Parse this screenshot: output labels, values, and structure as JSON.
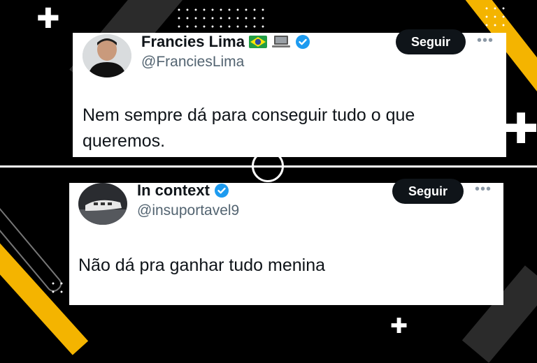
{
  "tweets": [
    {
      "name": "Francies Lima",
      "handle": "@FranciesLima",
      "follow_label": "Seguir",
      "more_label": "•••",
      "text": "Nem sempre dá para conseguir tudo o que queremos.",
      "badges": [
        "brazil-flag-icon",
        "laptop-icon",
        "verified-icon"
      ]
    },
    {
      "name": "In context",
      "handle": "@insuportavel9",
      "follow_label": "Seguir",
      "more_label": "•••",
      "text": "Não dá pra ganhar tudo menina",
      "badges": [
        "verified-icon"
      ]
    }
  ],
  "colors": {
    "background": "#000000",
    "accent_stripe": "#f4b400",
    "verified": "#1d9bf0",
    "follow_button": "#0f1419"
  }
}
